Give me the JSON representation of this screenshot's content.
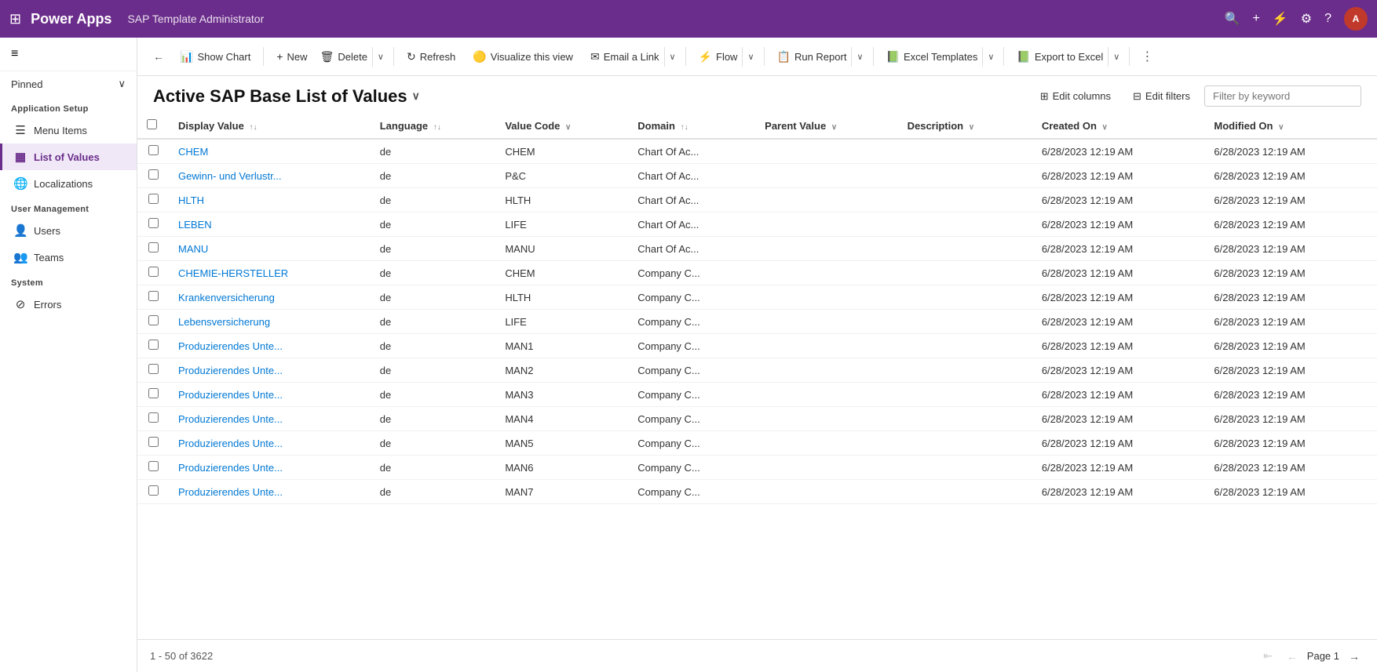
{
  "topNav": {
    "appName": "Power Apps",
    "appTitle": "SAP Template Administrator",
    "gridIconLabel": "⊞",
    "searchIconLabel": "🔍",
    "addIconLabel": "+",
    "filterIconLabel": "⚡",
    "settingsIconLabel": "⚙",
    "helpIconLabel": "?",
    "avatarInitials": "A"
  },
  "sidebar": {
    "hamburgerLabel": "≡",
    "pinnedLabel": "Pinned",
    "pinnedChevron": "∨",
    "groups": [
      {
        "label": "Application Setup",
        "items": [
          {
            "id": "menu-items",
            "label": "Menu Items",
            "icon": "☰",
            "active": false
          },
          {
            "id": "list-of-values",
            "label": "List of Values",
            "icon": "▦",
            "active": true
          },
          {
            "id": "localizations",
            "label": "Localizations",
            "icon": "🌐",
            "active": false
          }
        ]
      },
      {
        "label": "User Management",
        "items": [
          {
            "id": "users",
            "label": "Users",
            "icon": "👤",
            "active": false
          },
          {
            "id": "teams",
            "label": "Teams",
            "icon": "👥",
            "active": false
          }
        ]
      },
      {
        "label": "System",
        "items": [
          {
            "id": "errors",
            "label": "Errors",
            "icon": "⊘",
            "active": false
          }
        ]
      }
    ]
  },
  "toolbar": {
    "backLabel": "←",
    "showChartLabel": "Show Chart",
    "showChartIcon": "📊",
    "newLabel": "New",
    "newIcon": "+",
    "deleteLabel": "Delete",
    "deleteIcon": "🗑",
    "refreshLabel": "Refresh",
    "refreshIcon": "↻",
    "visualizeLabel": "Visualize this view",
    "visualizeIcon": "🟡",
    "emailLinkLabel": "Email a Link",
    "emailLinkIcon": "✉",
    "flowLabel": "Flow",
    "flowIcon": "⚡",
    "runReportLabel": "Run Report",
    "runReportIcon": "📋",
    "excelTemplatesLabel": "Excel Templates",
    "excelTemplatesIcon": "📗",
    "exportToExcelLabel": "Export to Excel",
    "exportToExcelIcon": "📗",
    "moreLabel": "⋮"
  },
  "pageHeader": {
    "title": "Active SAP Base List of Values",
    "titleChevron": "∨",
    "editColumnsLabel": "Edit columns",
    "editColumnsIcon": "⊞",
    "editFiltersLabel": "Edit filters",
    "editFiltersIcon": "⊟",
    "filterPlaceholder": "Filter by keyword"
  },
  "table": {
    "columns": [
      {
        "id": "display-value",
        "label": "Display Value",
        "sortIcon": "↑↓"
      },
      {
        "id": "language",
        "label": "Language",
        "sortIcon": "↑↓"
      },
      {
        "id": "value-code",
        "label": "Value Code",
        "sortIcon": "∨"
      },
      {
        "id": "domain",
        "label": "Domain",
        "sortIcon": "↑↓"
      },
      {
        "id": "parent-value",
        "label": "Parent Value",
        "sortIcon": "∨"
      },
      {
        "id": "description",
        "label": "Description",
        "sortIcon": "∨"
      },
      {
        "id": "created-on",
        "label": "Created On",
        "sortIcon": "∨"
      },
      {
        "id": "modified-on",
        "label": "Modified On",
        "sortIcon": "∨"
      }
    ],
    "rows": [
      {
        "displayValue": "CHEM",
        "language": "de",
        "valueCode": "CHEM",
        "domain": "Chart Of Ac...",
        "parentValue": "",
        "description": "",
        "createdOn": "6/28/2023 12:19 AM",
        "modifiedOn": "6/28/2023 12:19 AM"
      },
      {
        "displayValue": "Gewinn- und Verlustr...",
        "language": "de",
        "valueCode": "P&C",
        "domain": "Chart Of Ac...",
        "parentValue": "",
        "description": "",
        "createdOn": "6/28/2023 12:19 AM",
        "modifiedOn": "6/28/2023 12:19 AM"
      },
      {
        "displayValue": "HLTH",
        "language": "de",
        "valueCode": "HLTH",
        "domain": "Chart Of Ac...",
        "parentValue": "",
        "description": "",
        "createdOn": "6/28/2023 12:19 AM",
        "modifiedOn": "6/28/2023 12:19 AM"
      },
      {
        "displayValue": "LEBEN",
        "language": "de",
        "valueCode": "LIFE",
        "domain": "Chart Of Ac...",
        "parentValue": "",
        "description": "",
        "createdOn": "6/28/2023 12:19 AM",
        "modifiedOn": "6/28/2023 12:19 AM"
      },
      {
        "displayValue": "MANU",
        "language": "de",
        "valueCode": "MANU",
        "domain": "Chart Of Ac...",
        "parentValue": "",
        "description": "",
        "createdOn": "6/28/2023 12:19 AM",
        "modifiedOn": "6/28/2023 12:19 AM"
      },
      {
        "displayValue": "CHEMIE-HERSTELLER",
        "language": "de",
        "valueCode": "CHEM",
        "domain": "Company C...",
        "parentValue": "",
        "description": "",
        "createdOn": "6/28/2023 12:19 AM",
        "modifiedOn": "6/28/2023 12:19 AM"
      },
      {
        "displayValue": "Krankenversicherung",
        "language": "de",
        "valueCode": "HLTH",
        "domain": "Company C...",
        "parentValue": "",
        "description": "",
        "createdOn": "6/28/2023 12:19 AM",
        "modifiedOn": "6/28/2023 12:19 AM"
      },
      {
        "displayValue": "Lebensversicherung",
        "language": "de",
        "valueCode": "LIFE",
        "domain": "Company C...",
        "parentValue": "",
        "description": "",
        "createdOn": "6/28/2023 12:19 AM",
        "modifiedOn": "6/28/2023 12:19 AM"
      },
      {
        "displayValue": "Produzierendes Unte...",
        "language": "de",
        "valueCode": "MAN1",
        "domain": "Company C...",
        "parentValue": "",
        "description": "",
        "createdOn": "6/28/2023 12:19 AM",
        "modifiedOn": "6/28/2023 12:19 AM"
      },
      {
        "displayValue": "Produzierendes Unte...",
        "language": "de",
        "valueCode": "MAN2",
        "domain": "Company C...",
        "parentValue": "",
        "description": "",
        "createdOn": "6/28/2023 12:19 AM",
        "modifiedOn": "6/28/2023 12:19 AM"
      },
      {
        "displayValue": "Produzierendes Unte...",
        "language": "de",
        "valueCode": "MAN3",
        "domain": "Company C...",
        "parentValue": "",
        "description": "",
        "createdOn": "6/28/2023 12:19 AM",
        "modifiedOn": "6/28/2023 12:19 AM"
      },
      {
        "displayValue": "Produzierendes Unte...",
        "language": "de",
        "valueCode": "MAN4",
        "domain": "Company C...",
        "parentValue": "",
        "description": "",
        "createdOn": "6/28/2023 12:19 AM",
        "modifiedOn": "6/28/2023 12:19 AM"
      },
      {
        "displayValue": "Produzierendes Unte...",
        "language": "de",
        "valueCode": "MAN5",
        "domain": "Company C...",
        "parentValue": "",
        "description": "",
        "createdOn": "6/28/2023 12:19 AM",
        "modifiedOn": "6/28/2023 12:19 AM"
      },
      {
        "displayValue": "Produzierendes Unte...",
        "language": "de",
        "valueCode": "MAN6",
        "domain": "Company C...",
        "parentValue": "",
        "description": "",
        "createdOn": "6/28/2023 12:19 AM",
        "modifiedOn": "6/28/2023 12:19 AM"
      },
      {
        "displayValue": "Produzierendes Unte...",
        "language": "de",
        "valueCode": "MAN7",
        "domain": "Company C...",
        "parentValue": "",
        "description": "",
        "createdOn": "6/28/2023 12:19 AM",
        "modifiedOn": "6/28/2023 12:19 AM"
      }
    ]
  },
  "footer": {
    "recordsInfo": "1 - 50 of 3622",
    "pageLabel": "Page 1"
  }
}
